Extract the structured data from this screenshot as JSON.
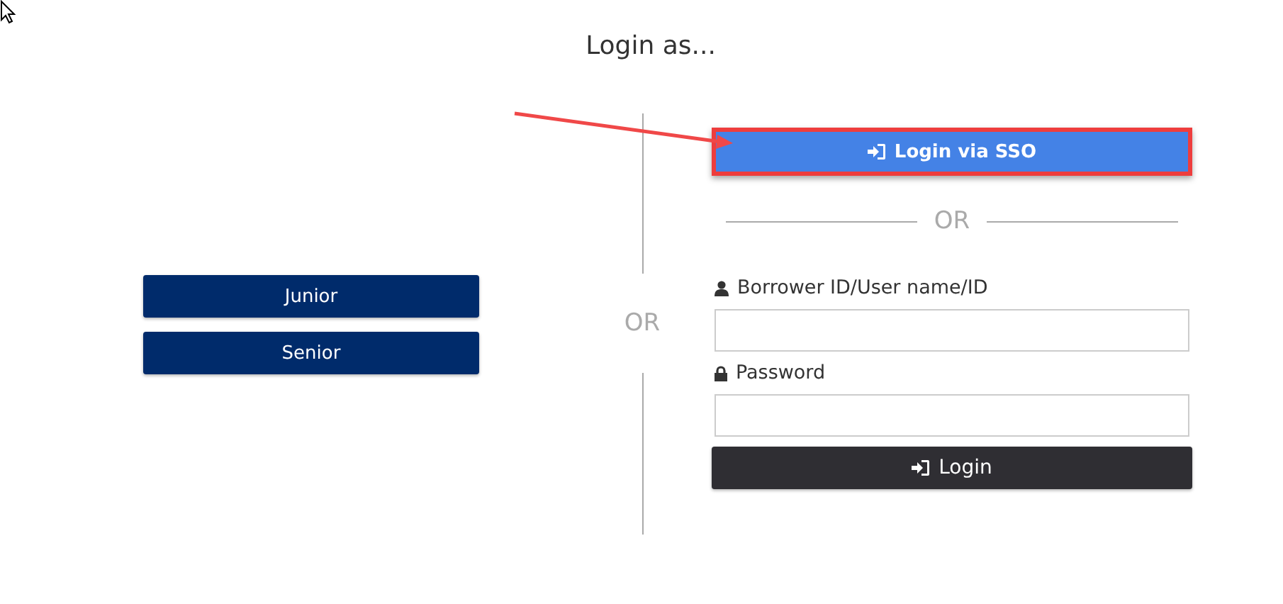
{
  "title": "Login as...",
  "groups": [
    {
      "label": "Junior"
    },
    {
      "label": "Senior"
    }
  ],
  "divider_label": "OR",
  "sso_button": {
    "label": "Login via SSO",
    "highlighted": true
  },
  "sso_divider_label": "OR",
  "fields": [
    {
      "label": "Borrower ID/User name/ID",
      "kind": "user"
    },
    {
      "label": "Password",
      "kind": "lock"
    }
  ],
  "login_button": {
    "label": "Login"
  }
}
